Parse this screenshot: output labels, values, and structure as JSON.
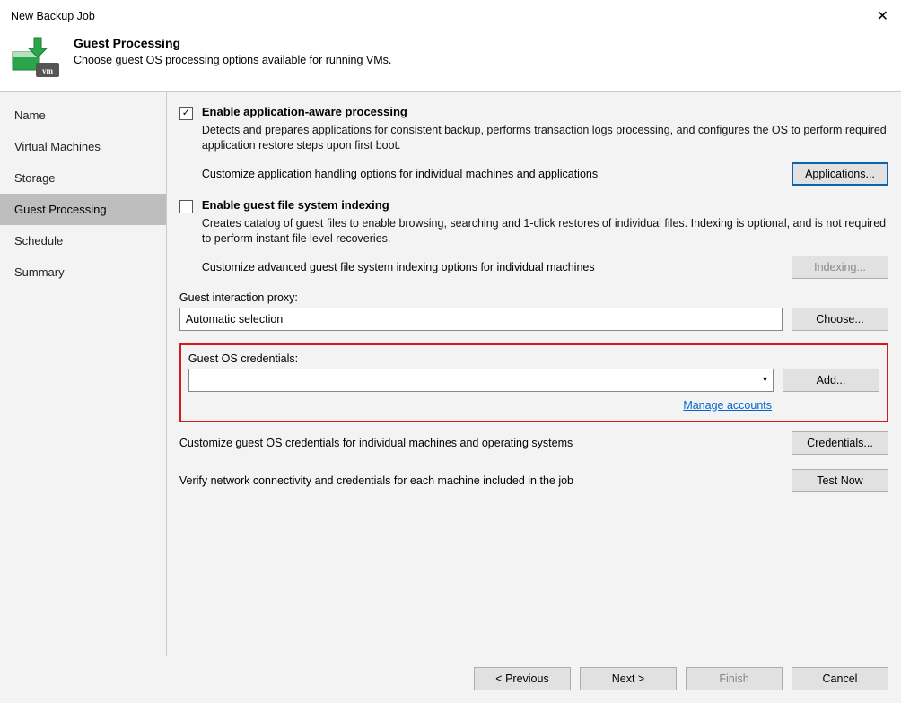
{
  "window": {
    "title": "New Backup Job"
  },
  "header": {
    "title": "Guest Processing",
    "subtitle": "Choose guest OS processing options available for running VMs."
  },
  "sidebar": {
    "items": [
      {
        "label": "Name"
      },
      {
        "label": "Virtual Machines"
      },
      {
        "label": "Storage"
      },
      {
        "label": "Guest Processing"
      },
      {
        "label": "Schedule"
      },
      {
        "label": "Summary"
      }
    ],
    "active_index": 3
  },
  "app_aware": {
    "checked": true,
    "label": "Enable application-aware processing",
    "desc": "Detects and prepares applications for consistent backup, performs transaction logs processing, and configures the OS to perform required application restore steps upon first boot.",
    "customize_text": "Customize application handling options for individual machines and applications",
    "button": "Applications..."
  },
  "indexing": {
    "checked": false,
    "label": "Enable guest file system indexing",
    "desc": "Creates catalog of guest files to enable browsing, searching and 1-click restores of individual files. Indexing is optional, and is not required to perform instant file level recoveries.",
    "customize_text": "Customize advanced guest file system indexing options for individual machines",
    "button": "Indexing..."
  },
  "proxy": {
    "label": "Guest interaction proxy:",
    "value": "Automatic selection",
    "button": "Choose..."
  },
  "credentials": {
    "label": "Guest OS credentials:",
    "value": "",
    "add_button": "Add...",
    "manage_link": "Manage accounts",
    "customize_text": "Customize guest OS credentials for individual machines and operating systems",
    "credentials_button": "Credentials..."
  },
  "verify": {
    "text": "Verify network connectivity and credentials for each machine included in the job",
    "button": "Test Now"
  },
  "footer": {
    "previous": "< Previous",
    "next": "Next >",
    "finish": "Finish",
    "cancel": "Cancel"
  }
}
